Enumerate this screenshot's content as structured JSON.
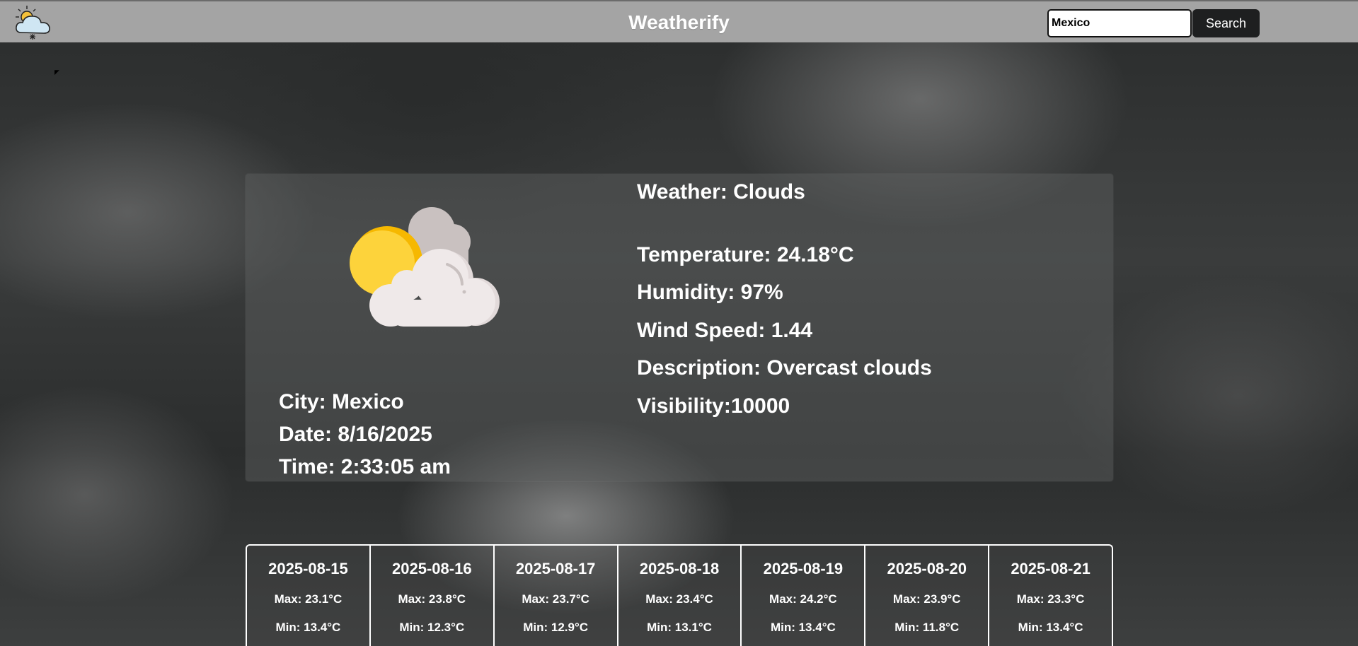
{
  "header": {
    "title": "Weatherify",
    "logo_icon": "sun-cloud-snow-icon",
    "search": {
      "value": "Mexico",
      "placeholder": "",
      "button_label": "Search"
    }
  },
  "current": {
    "icon": "partly-cloudy-icon",
    "city": "City: Mexico",
    "date": "Date: 8/16/2025",
    "time": "Time: 2:33:05 am",
    "weather": "Weather: Clouds",
    "temperature": "Temperature: 24.18°C",
    "humidity": "Humidity: 97%",
    "wind_speed": "Wind Speed: 1.44",
    "description": "Description: Overcast clouds",
    "visibility": "Visibility:10000"
  },
  "forecast": [
    {
      "date": "2025-08-15",
      "max": "Max: 23.1°C",
      "min": "Min: 13.4°C"
    },
    {
      "date": "2025-08-16",
      "max": "Max: 23.8°C",
      "min": "Min: 12.3°C"
    },
    {
      "date": "2025-08-17",
      "max": "Max: 23.7°C",
      "min": "Min: 12.9°C"
    },
    {
      "date": "2025-08-18",
      "max": "Max: 23.4°C",
      "min": "Min: 13.1°C"
    },
    {
      "date": "2025-08-19",
      "max": "Max: 24.2°C",
      "min": "Min: 13.4°C"
    },
    {
      "date": "2025-08-20",
      "max": "Max: 23.9°C",
      "min": "Min: 11.8°C"
    },
    {
      "date": "2025-08-21",
      "max": "Max: 23.3°C",
      "min": "Min: 13.4°C"
    }
  ],
  "colors": {
    "navbar": "#a4a4a4",
    "search_button": "#1e1f20",
    "sun": "#fdd33b",
    "cloud": "#eee8e8"
  }
}
